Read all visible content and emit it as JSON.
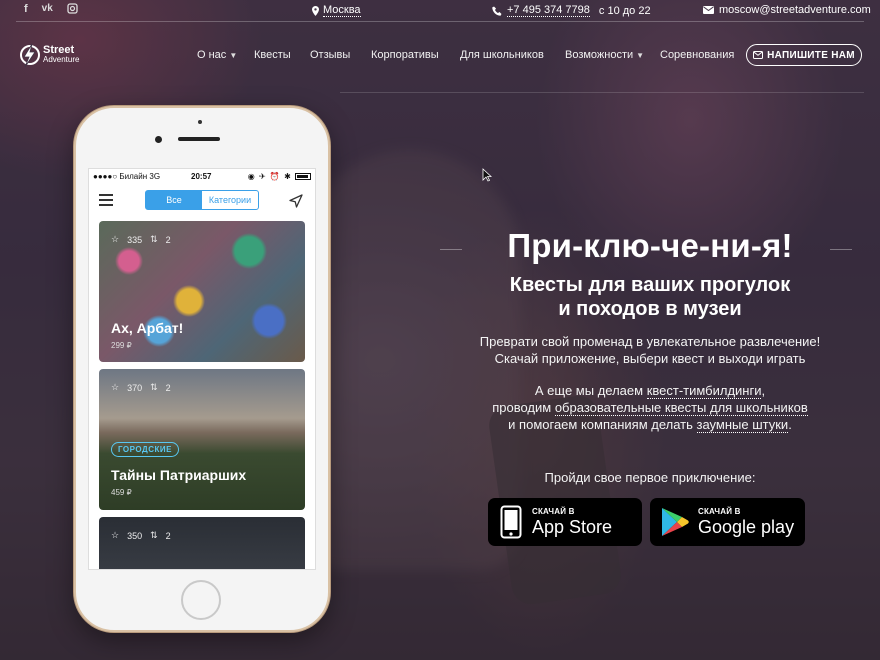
{
  "topbar": {
    "social": [
      "f",
      "vk",
      "inst"
    ],
    "city": "Москва",
    "phone": "+7 495 374 7798",
    "hours": "с 10 до 22",
    "email": "moscow@streetadventure.com"
  },
  "logo": {
    "line1": "Street",
    "line2": "Adventure"
  },
  "nav": {
    "items": [
      "О нас",
      "Квесты",
      "Отзывы",
      "Корпоративы",
      "Для школьников",
      "Возможности",
      "Соревнования"
    ],
    "write_button": "НАПИШИТЕ НАМ"
  },
  "phone": {
    "status": {
      "carrier": "Билайн",
      "network": "3G",
      "time": "20:57"
    },
    "segment": {
      "all": "Все",
      "categories": "Категории"
    },
    "cards": [
      {
        "rating": "335",
        "count": "2",
        "tag": "",
        "title": "Ах, Арбат!",
        "price": "299 ₽"
      },
      {
        "rating": "370",
        "count": "2",
        "tag": "ГОРОДСКИЕ",
        "title": "Тайны Патриарших",
        "price": "459 ₽"
      },
      {
        "rating": "350",
        "count": "2",
        "tag": "",
        "title": "",
        "price": ""
      }
    ]
  },
  "hero": {
    "title": "При-клю-че-ни-я!",
    "subtitle_line1": "Квесты для ваших прогулок",
    "subtitle_line2": "и походов в музеи",
    "p1_line1": "Преврати свой променад в увлекательное развлечение!",
    "p1_line2": "Скачай приложение, выбери квест и выходи играть",
    "p2_prefix": "А еще мы делаем",
    "p2_link1": "квест-тимбилдинги",
    "p2_mid": "проводим",
    "p2_link2": "образовательные квесты для школьников",
    "p2_end": "и помогаем компаниям делать",
    "p2_link3": "заумные штуки",
    "cta": "Пройди свое первое приключение:"
  },
  "stores": {
    "appstore": {
      "small": "СКАЧАЙ В",
      "big": "App Store"
    },
    "googleplay": {
      "small": "СКАЧАЙ В",
      "big": "Google play"
    }
  }
}
